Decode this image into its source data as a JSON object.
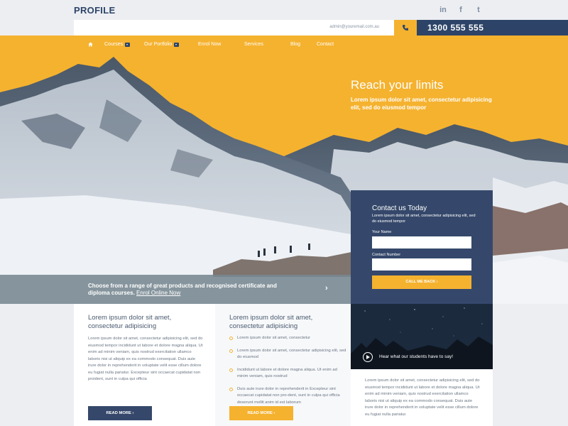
{
  "brand": "PROFILE",
  "social": [
    {
      "icon": "linkedin-icon",
      "glyph": "in"
    },
    {
      "icon": "facebook-icon",
      "glyph": "f"
    },
    {
      "icon": "twitter-icon",
      "glyph": "t"
    }
  ],
  "contact": {
    "email": "admin@youremail.com.au",
    "phone": "1300 555 555"
  },
  "nav": {
    "home_icon": "home-icon",
    "items": [
      {
        "label": "Courses",
        "dropdown": true
      },
      {
        "label": "Our Portfolio",
        "dropdown": true
      },
      {
        "label": "Enrol Now",
        "dropdown": false
      },
      {
        "label": "Services",
        "dropdown": false
      },
      {
        "label": "Blog",
        "dropdown": false
      },
      {
        "label": "Contact",
        "dropdown": false
      }
    ]
  },
  "hero": {
    "title": "Reach your limits",
    "subtitle": "Lorem ipsum dolor sit amet, consectetur adipisicing elit, sed do eiusmod tempor"
  },
  "course_strip": {
    "text": "Choose from a range of great products and recognised certificate and diploma courses.",
    "link": "Enrol Online Now"
  },
  "contact_form": {
    "title": "Contact us Today",
    "description": "Lorem ipsum dolor sit amet, consectetur adipisicing elit, sed do eiusmod tempor",
    "name_label": "Your Name",
    "number_label": "Contact Number",
    "button": "CALL ME BACK"
  },
  "columns": {
    "col1": {
      "heading": "Lorem ipsum dolor sit amet, consectetur adipisicing",
      "body": "Lorem ipsum dolor sit amet, consectetur adipisicing elit, sed do eiusmod tempor incididunt ut labore et dolore magna aliqua. Ut enim ad minim veniam, quis nostrud exercitation ullamco laboris nisi ut aliquip ex ea commodo consequat. Duis aute irure dolor in reprehenderit in voluptate velit esse cillum dolore eu fugiat nulla pariatur. Excepteur sint occaecat cupidatat non proident, sunt in culpa qui officia",
      "button": "READ MORE"
    },
    "col2": {
      "heading": "Lorem ipsum dolor sit amet, consectetur adipisicing",
      "bullets": [
        "Lorem ipsum dolor sit amet, consectetur",
        "Lorem ipsum dolor sit amet, consectetur adipisicing elit, sed do eiusmod",
        "Incididunt ut labore et dolore magna aliqua. Ut enim ad minim veniam, quis nostrud",
        "Duis aute irure dolor in reprehenderit in Excepteur sint occaecat cupidatat non pro-dent, sunt in culpa qui officia deserunt mollit anim id est laborum"
      ],
      "button": "READ MORE"
    },
    "col3": {
      "video_caption": "Hear what our students have to say!",
      "body": "Lorem ipsum dolor sit amet, consectetur adipisicing elit, sed do eiusmod tempor incididunt ut labore et dolore magna aliqua. Ut enim ad minim veniam, quis nostrud exercitation ullamco laboris nisi ut aliquip ex ea commodo consequat. Duis aute irure dolor in reprehenderit in voluptate velit esse cillum dolore eu fugiat nulla pariatur."
    }
  },
  "colors": {
    "accent": "#f5b22f",
    "navy": "#2d4468"
  }
}
